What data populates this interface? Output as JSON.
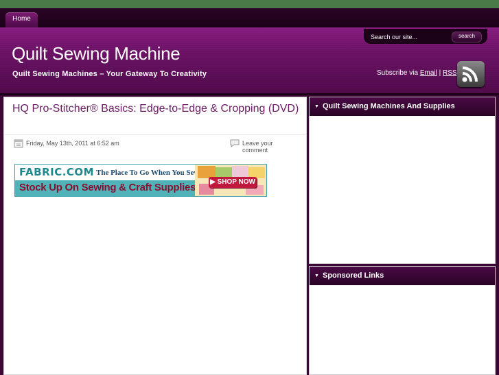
{
  "nav": {
    "home": "Home"
  },
  "header": {
    "site_title": "Quilt Sewing Machine",
    "tagline": "Quilt Sewing Machines – Your Gateway To Creativity",
    "search_placeholder": "Search our site...",
    "search_button": "search",
    "subscribe_prefix": "Subscribe via",
    "subscribe_email": "Email",
    "subscribe_sep": "|",
    "subscribe_rss": "RSS"
  },
  "post": {
    "title": "HQ Pro-Stitcher® Basics: Edge-to-Edge & Cropping (DVD)",
    "date": "Friday, May 13th, 2011 at 6:52 am",
    "comment_link": "Leave your comment",
    "banner": {
      "brand": "FABRIC.COM",
      "tagline": "The Place To Go When You Sew",
      "headline": "Stock Up On Sewing & Craft Supplies",
      "cta": "▶ SHOP NOW"
    }
  },
  "sidebar": {
    "widgets": [
      {
        "title": "Quilt Sewing Machines And Supplies"
      },
      {
        "title": "Sponsored Links"
      }
    ]
  },
  "colors": {
    "header_purple": "#6c1266",
    "nav_dark": "#1c0219",
    "title_link": "#6a1a64",
    "top_strip": "#4a7a48"
  }
}
